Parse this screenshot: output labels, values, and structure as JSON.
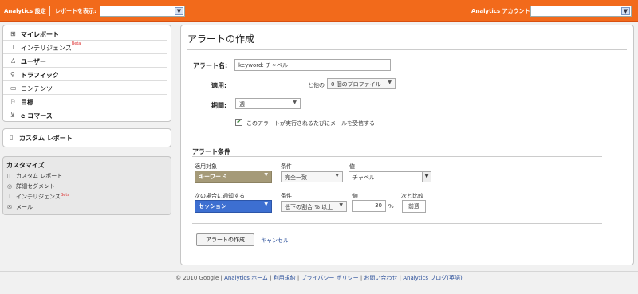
{
  "topbar": {
    "analytics_settings": "Analytics 設定",
    "view_reports": "レポートを表示:",
    "account_label": "Analytics アカウント:"
  },
  "sidebar": {
    "items": [
      {
        "label": "マイレポート",
        "icon": "dashboard-icon"
      },
      {
        "label": "インテリジェンス",
        "icon": "chart-icon",
        "badge": "Beta"
      },
      {
        "label": "ユーザー",
        "icon": "user-icon"
      },
      {
        "label": "トラフィック",
        "icon": "traffic-icon"
      },
      {
        "label": "コンテンツ",
        "icon": "document-icon"
      },
      {
        "label": "目標",
        "icon": "flag-icon"
      },
      {
        "label": "e コマース",
        "icon": "cart-icon"
      }
    ],
    "custom_reports": "カスタム レポート",
    "customize": {
      "title": "カスタマイズ",
      "items": [
        {
          "label": "カスタム レポート",
          "icon": "report-icon"
        },
        {
          "label": "詳細セグメント",
          "icon": "segment-icon"
        },
        {
          "label": "インテリジェンス",
          "icon": "chart-icon",
          "badge": "Beta"
        },
        {
          "label": "メール",
          "icon": "mail-icon"
        }
      ]
    }
  },
  "main": {
    "title": "アラートの作成",
    "alert_name_label": "アラート名:",
    "alert_name_value": "keyword: チャベル",
    "apply_label": "適用:",
    "apply_suffix": "と他の",
    "profiles_value": "0 個のプロファイル",
    "period_label": "期間:",
    "period_value": "週",
    "email_checkbox_label": "このアラートが実行されるたびにメールを受信する",
    "conditions_title": "アラート条件",
    "target_label": "適用対象",
    "target_value": "キーワード",
    "condition_label": "条件",
    "condition_value": "完全一致",
    "value_label": "値",
    "value_value": "チャベル",
    "notify_label": "次の場合に通知する",
    "notify_value": "セッション",
    "condition2_label": "条件",
    "condition2_value": "低下の割合 % 以上",
    "value2_label": "値",
    "value2_value": "30",
    "percent": "%",
    "compare_label": "次と比較",
    "compare_value": "前週",
    "create_button": "アラートの作成",
    "cancel_link": "キャンセル"
  },
  "footer": {
    "copyright": "© 2010 Google",
    "links": [
      "Analytics ホーム",
      "利用規約",
      "プライバシー ポリシー",
      "お問い合わせ",
      "Analytics ブログ(英語)"
    ]
  },
  "colors": {
    "topbar": "#f26a1b",
    "target_select": "#a59a78",
    "notify_select": "#3d6fd1",
    "link": "#2a4f9a"
  }
}
